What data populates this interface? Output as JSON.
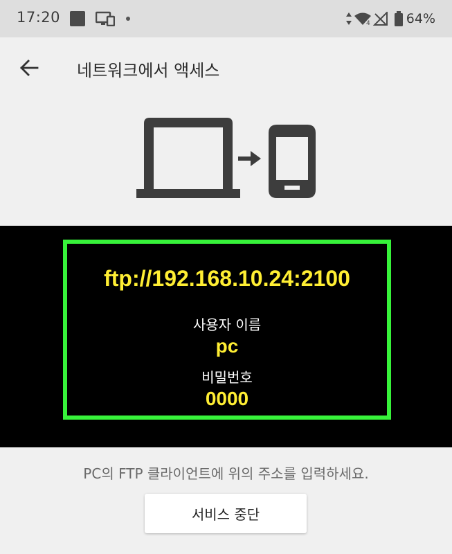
{
  "status_bar": {
    "time": "17:20",
    "battery": "64%",
    "icons": [
      "sd-card-icon",
      "cast-icon",
      "notification-dot-icon",
      "data-arrows-icon",
      "wifi-icon",
      "no-signal-icon",
      "battery-icon"
    ]
  },
  "app_bar": {
    "title": "네트워크에서 액세스",
    "back_icon": "arrow-left-icon"
  },
  "illustration": {
    "icons": [
      "laptop-icon",
      "arrow-right-icon",
      "smartphone-icon"
    ]
  },
  "connection": {
    "address": "ftp://192.168.10.24:2100",
    "username_label": "사용자 이름",
    "username": "pc",
    "password_label": "비밀번호",
    "password": "0000"
  },
  "instruction": "PC의 FTP 클라이언트에 위의 주소를 입력하세요.",
  "stop_button_label": "서비스 중단",
  "colors": {
    "highlight_border": "#37f23a",
    "highlight_text": "#ffee33",
    "panel_background": "#000000",
    "page_background": "#f0f0f0",
    "status_bar_background": "#dedede"
  }
}
